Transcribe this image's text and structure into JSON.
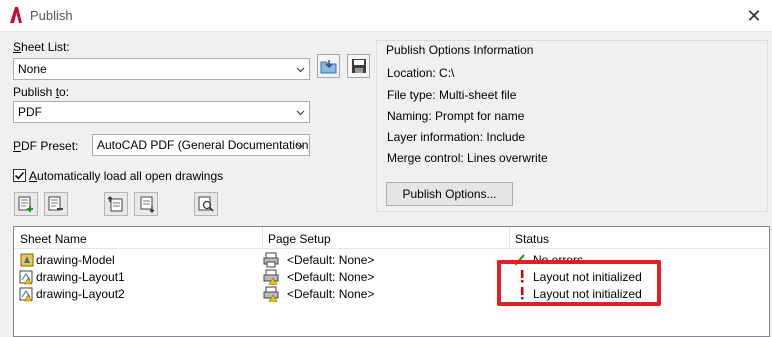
{
  "window": {
    "title": "Publish",
    "close_symbol": "✕",
    "logo": "autocad-logo"
  },
  "sheet_list": {
    "label_prefix": "S",
    "label_rest": "heet List:",
    "value": "None"
  },
  "publish_to": {
    "label_prefix": "Publish ",
    "label_u": "t",
    "label_rest": "o:",
    "value": "PDF"
  },
  "pdf_preset": {
    "label_u": "P",
    "label_rest": "DF Preset:",
    "value": "AutoCAD PDF (General Documentation)"
  },
  "auto_load": {
    "label_u": "A",
    "label_rest": "utomatically load all open drawings",
    "checked": true
  },
  "publish_options_info": {
    "title": "Publish Options Information",
    "location": "Location: C:\\",
    "file_type": "File type: Multi-sheet file",
    "naming": "Naming: Prompt for name",
    "layer_info": "Layer information: Include",
    "merge_control": "Merge control: Lines overwrite",
    "button_label": "Publish Options..."
  },
  "sheet_table": {
    "columns": [
      "Sheet Name",
      "Page Setup",
      "Status"
    ],
    "rows": [
      {
        "sheet": "drawing-Model",
        "page_setup": "<Default: None>",
        "status": "No errors"
      },
      {
        "sheet": "drawing-Layout1",
        "page_setup": "<Default: None>",
        "status": "Layout not initialized"
      },
      {
        "sheet": "drawing-Layout2",
        "page_setup": "<Default: None>",
        "status": "Layout not initialized"
      }
    ]
  },
  "colors": {
    "highlight": "#e02020",
    "warning": "#d40000",
    "ok": "#2a9d2a"
  }
}
